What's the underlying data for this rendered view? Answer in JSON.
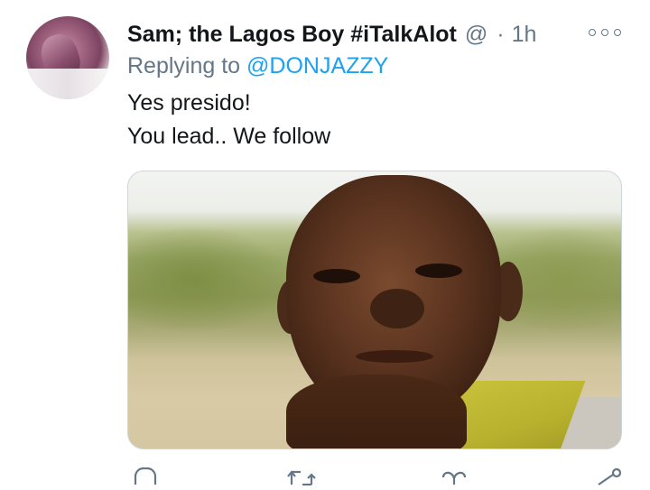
{
  "tweet": {
    "author_name": "Sam; the Lagos Boy #iTalkAlot",
    "handle": "@",
    "separator": "·",
    "time": "1h",
    "replying_prefix": "Replying to",
    "replying_to": "@DONJAZZY",
    "text_lines": [
      "Yes presido!",
      "You lead.. We follow"
    ]
  },
  "icons": {
    "more": "more-options-icon",
    "reply": "reply-icon",
    "retweet": "retweet-icon",
    "like": "like-icon",
    "share": "share-icon"
  },
  "colors": {
    "text": "#14171a",
    "secondary": "#657786",
    "link": "#1da1f2",
    "border": "#ccd6dd"
  }
}
